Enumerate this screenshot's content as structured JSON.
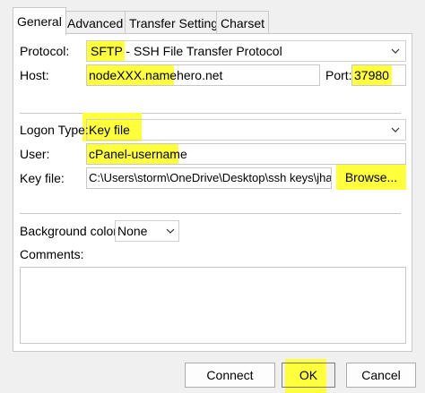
{
  "tabs": [
    "General",
    "Advanced",
    "Transfer Settings",
    "Charset"
  ],
  "general": {
    "protocol_label": "Protocol:",
    "protocol_value_highlight": "SFTP",
    "protocol_value_rest": " - SSH File Transfer Protocol",
    "host_label": "Host:",
    "host_value": "nodeXXX.namehero.net",
    "port_label": "Port:",
    "port_value": "37980",
    "logon_type_label": "Logon Type:",
    "logon_type_value": "Key file",
    "user_label": "User:",
    "user_value": "cPanel-username",
    "key_file_label": "Key file:",
    "key_file_value": "C:\\Users\\storm\\OneDrive\\Desktop\\ssh keys\\jhar",
    "browse_label": "Browse...",
    "background_color_label": "Background color:",
    "background_color_value": "None",
    "comments_label": "Comments:",
    "comments_value": ""
  },
  "buttons": {
    "connect": "Connect",
    "ok": "OK",
    "cancel": "Cancel"
  },
  "colors": {
    "highlight": "#ffff3c",
    "panel_bg": "#ffffff",
    "window_bg": "#f0f0f0"
  }
}
